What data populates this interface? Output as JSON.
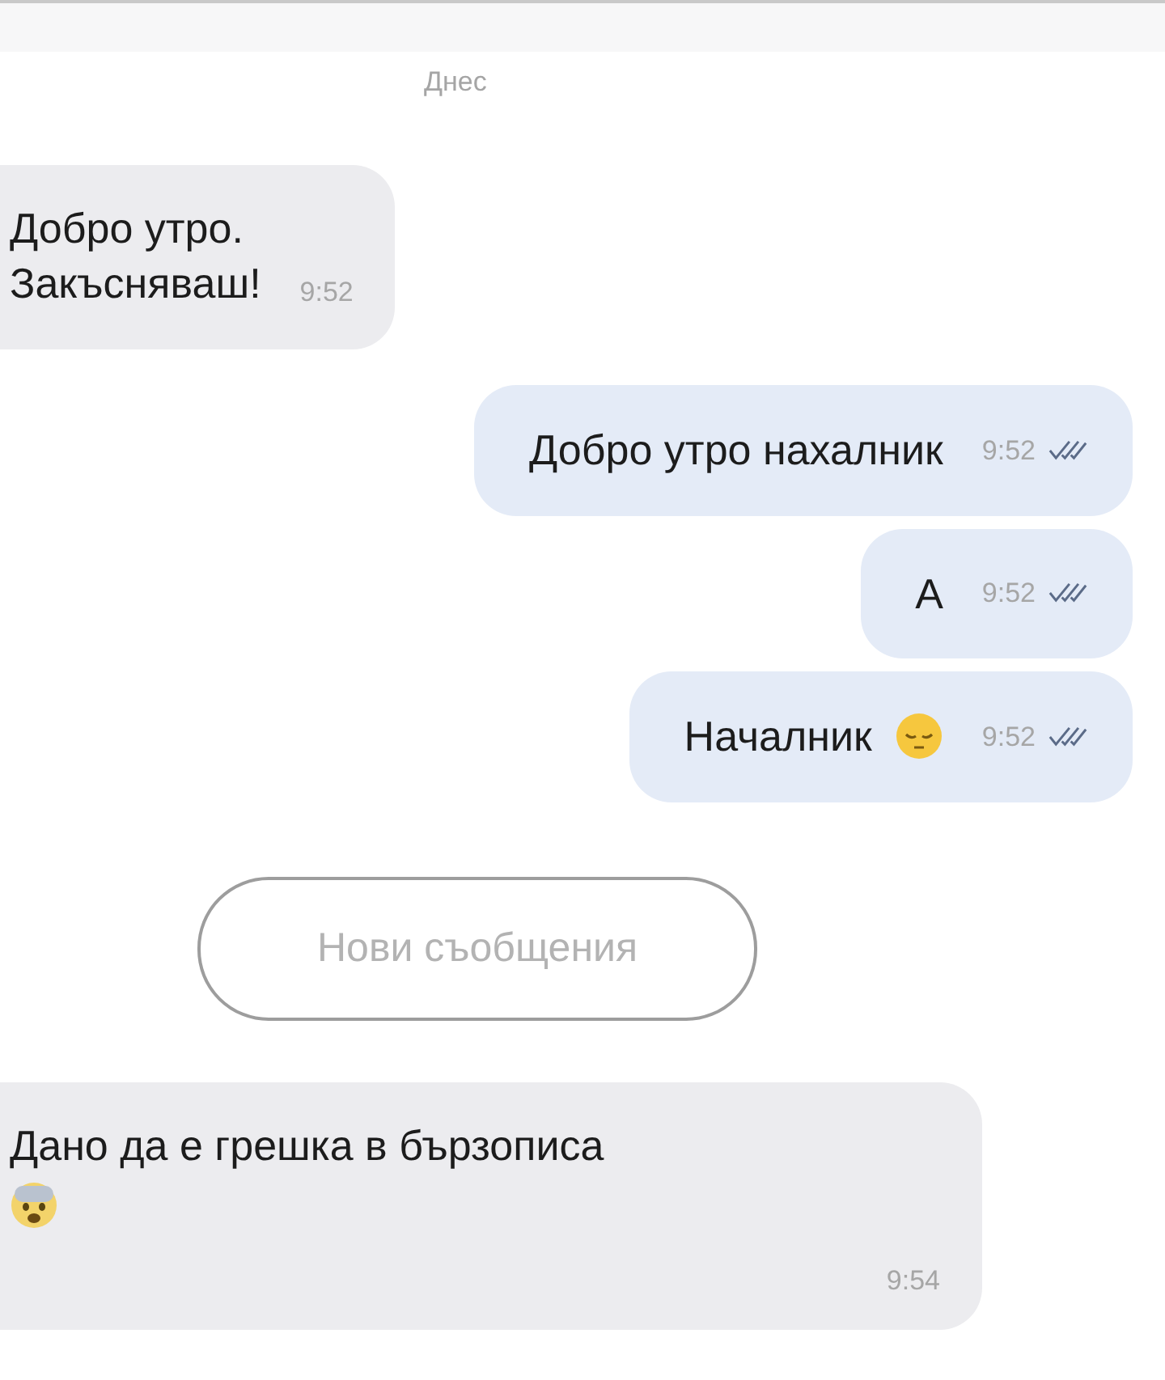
{
  "date_separator": "Днес",
  "messages": [
    {
      "kind": "incoming",
      "lines": [
        "Добро утро.",
        "Закъсняваш!"
      ],
      "time": "9:52"
    },
    {
      "kind": "outgoing",
      "lines": [
        "Добро утро нахалник"
      ],
      "time": "9:52",
      "read": true
    },
    {
      "kind": "outgoing",
      "lines": [
        "А"
      ],
      "time": "9:52",
      "read": true
    },
    {
      "kind": "outgoing",
      "lines": [
        "Началник"
      ],
      "time": "9:52",
      "read": true,
      "emoji": true
    },
    {
      "kind": "divider",
      "label": "Нови съобщения"
    },
    {
      "kind": "incoming",
      "lines": [
        "Дано да е грешка в бързописа"
      ],
      "time": "9:54",
      "emoji": true
    }
  ]
}
